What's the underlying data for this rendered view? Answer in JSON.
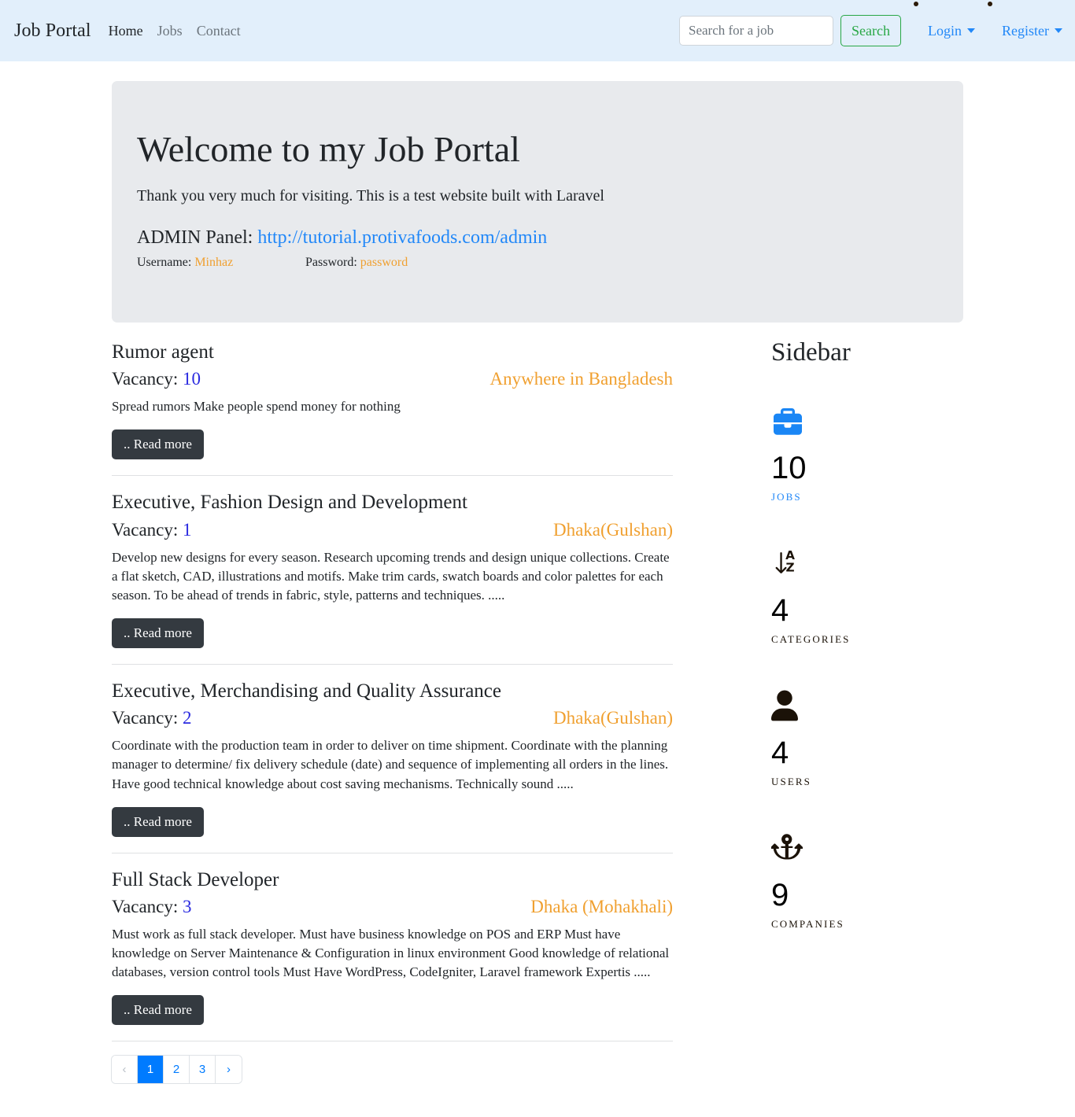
{
  "navbar": {
    "brand": "Job Portal",
    "links": [
      {
        "label": "Home",
        "active": true
      },
      {
        "label": "Jobs",
        "active": false
      },
      {
        "label": "Contact",
        "active": false
      }
    ],
    "search": {
      "placeholder": "Search for a job",
      "value": "",
      "button_label": "Search"
    },
    "auth": [
      {
        "label": "Login"
      },
      {
        "label": "Register"
      }
    ]
  },
  "hero": {
    "title": "Welcome to my Job Portal",
    "lead": "Thank you very much for visiting. This is a test website built with Laravel",
    "admin_prefix": "ADMIN Panel:",
    "admin_url": "http://tutorial.protivafoods.com/admin",
    "username_label": "Username:",
    "username_value": "Minhaz",
    "password_label": "Password:",
    "password_value": "password"
  },
  "jobs": {
    "vacancy_label": "Vacancy:",
    "read_more_label": ".. Read more",
    "items": [
      {
        "title": "Rumor agent",
        "vacancy": "10",
        "location": "Anywhere in Bangladesh",
        "description": "Spread rumors Make people spend money for nothing"
      },
      {
        "title": "Executive, Fashion Design and Development",
        "vacancy": "1",
        "location": "Dhaka(Gulshan)",
        "description": "Develop new designs for every season. Research upcoming trends and design unique collections. Create a flat sketch, CAD, illustrations and motifs. Make trim cards, swatch boards and color palettes for each season. To be ahead of trends in fabric, style, patterns and techniques.   ....."
      },
      {
        "title": "Executive, Merchandising and Quality Assurance",
        "vacancy": "2",
        "location": "Dhaka(Gulshan)",
        "description": "Coordinate with the production team in order to deliver on time shipment. Coordinate with the planning manager to determine/ fix delivery schedule (date) and sequence of implementing all orders in the lines. Have good technical knowledge about cost saving mechanisms. Technically sound   ....."
      },
      {
        "title": "Full Stack Developer",
        "vacancy": "3",
        "location": "Dhaka (Mohakhali)",
        "description": "Must work as full stack developer. Must have business knowledge on POS and ERP Must have knowledge on Server Maintenance & Configuration in linux environment Good knowledge of relational databases, version control tools Must Have WordPress, CodeIgniter, Laravel framework Expertis   ....."
      }
    ]
  },
  "pagination": {
    "prev": "‹",
    "next": "›",
    "pages": [
      "1",
      "2",
      "3"
    ],
    "active": "1"
  },
  "sidebar": {
    "title": "Sidebar",
    "stats": [
      {
        "icon": "briefcase-icon",
        "value": "10",
        "label": "JOBS",
        "color": "#1a86f5"
      },
      {
        "icon": "sort-alpha-down-icon",
        "value": "4",
        "label": "CATEGORIES",
        "color": "#1b1208"
      },
      {
        "icon": "user-icon",
        "value": "4",
        "label": "USERS",
        "color": "#1b1208"
      },
      {
        "icon": "anchor-icon",
        "value": "9",
        "label": "COMPANIES",
        "color": "#1b1208"
      }
    ]
  }
}
